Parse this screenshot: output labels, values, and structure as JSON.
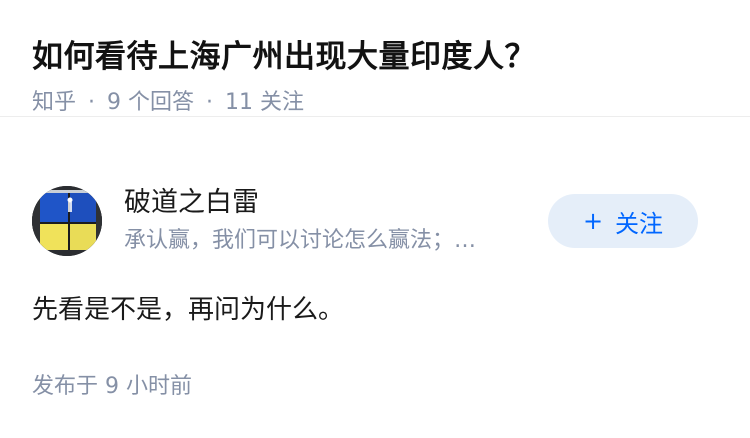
{
  "question": {
    "title": "如何看待上海广州出现大量印度人？",
    "source": "知乎",
    "separator": "·",
    "answers": "9 个回答",
    "followers": "11 关注"
  },
  "answer": {
    "author": {
      "name": "破道之白雷",
      "headline": "承认赢，我们可以讨论怎么赢法；…",
      "avatar": "avatar-image"
    },
    "follow": {
      "plus": "+",
      "label": "关注"
    },
    "content": "先看是不是，再问为什么。",
    "published": "发布于 9 小时前"
  },
  "colors": {
    "meta_text": "#8590a6",
    "follow_bg": "#e5eef9",
    "follow_text": "#0066ff"
  }
}
